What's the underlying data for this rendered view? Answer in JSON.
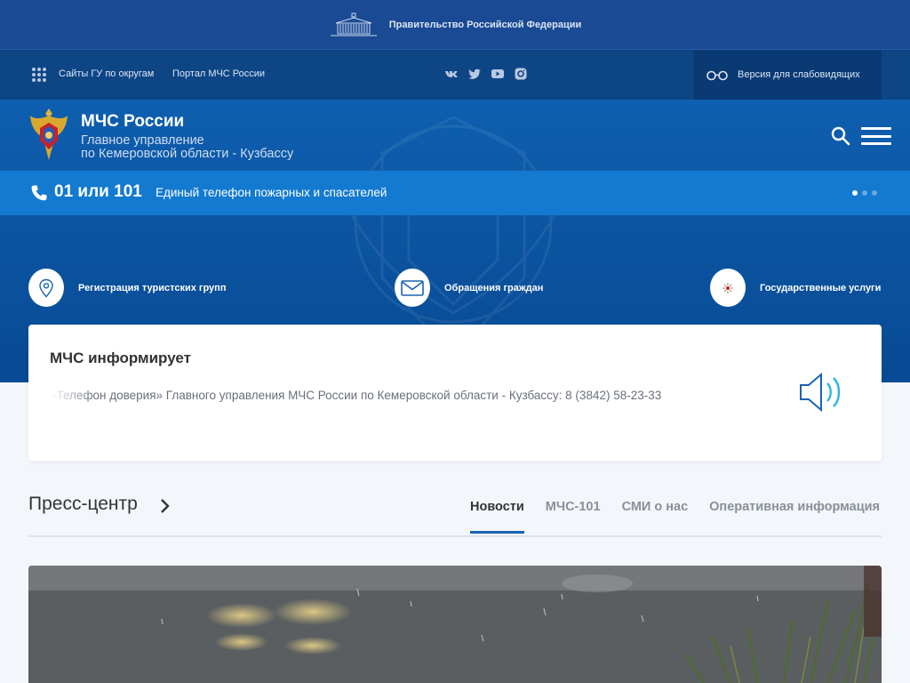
{
  "gov_bar": {
    "text": "Правительство Российской Федерации",
    "icon": "government-building-icon"
  },
  "top_bar": {
    "menu_icon": "apps-grid-icon",
    "links": [
      "Сайты ГУ по округам",
      "Портал МЧС России"
    ],
    "social": [
      "vk-icon",
      "twitter-icon",
      "youtube-icon",
      "instagram-icon"
    ],
    "vision_label": "Версия для слабовидящих",
    "vision_icon": "glasses-icon"
  },
  "header": {
    "title": "МЧС России",
    "subtitle_line1": "Главное управление",
    "subtitle_line2": "по Кемеровской области - Кузбассу",
    "search_icon": "search-icon",
    "menu_icon": "hamburger-icon"
  },
  "phone_bar": {
    "number": "01 или 101",
    "description": "Единый телефон пожарных и спасателей",
    "slides": 3,
    "active_slide": 1
  },
  "quick_links": [
    {
      "label": "Регистрация туристских групп",
      "icon": "location-pin-icon"
    },
    {
      "label": "Обращения граждан",
      "icon": "envelope-icon"
    },
    {
      "label": "Государственные услуги",
      "icon": "services-icon"
    }
  ],
  "info": {
    "title": "МЧС информирует",
    "ticker": "«Телефон доверия» Главного управления МЧС России по Кемеровской области - Кузбассу: 8 (3842) 58-23-33",
    "speaker_icon": "speaker-icon"
  },
  "press": {
    "title": "Пресс-центр",
    "tabs": [
      {
        "label": "Новости",
        "active": true
      },
      {
        "label": "МЧС-101",
        "active": false
      },
      {
        "label": "СМИ о нас",
        "active": false
      },
      {
        "label": "Оперативная информация",
        "active": false
      }
    ]
  },
  "colors": {
    "header_blue": "#0e4585",
    "phone_blue": "#137ad0",
    "accent": "#1a63b3"
  }
}
